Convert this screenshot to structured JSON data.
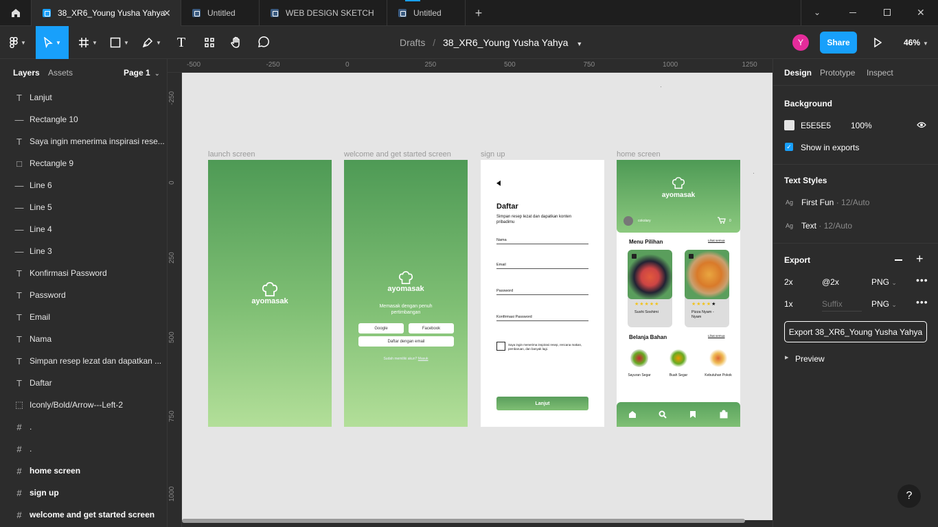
{
  "tabs": [
    {
      "label": "38_XR6_Young Yusha Yahya",
      "active": true
    },
    {
      "label": "Untitled"
    },
    {
      "label": "WEB DESIGN SKETCH"
    },
    {
      "label": "Untitled"
    }
  ],
  "toolbar": {
    "breadcrumb_root": "Drafts",
    "breadcrumb_sep": "/",
    "file_name": "38_XR6_Young Yusha Yahya",
    "avatar_letter": "Y",
    "share_label": "Share",
    "zoom": "46%"
  },
  "left_panel": {
    "tabs": [
      "Layers",
      "Assets"
    ],
    "page": "Page 1",
    "layers": [
      {
        "icon": "text-icon",
        "glyph": "T",
        "label": "Lanjut"
      },
      {
        "icon": "line-icon",
        "glyph": "—",
        "label": "Rectangle 10"
      },
      {
        "icon": "text-icon",
        "glyph": "T",
        "label": "Saya ingin menerima inspirasi rese..."
      },
      {
        "icon": "rectangle-icon",
        "glyph": "□",
        "label": "Rectangle 9"
      },
      {
        "icon": "line-icon",
        "glyph": "—",
        "label": "Line 6"
      },
      {
        "icon": "line-icon",
        "glyph": "—",
        "label": "Line 5"
      },
      {
        "icon": "line-icon",
        "glyph": "—",
        "label": "Line 4"
      },
      {
        "icon": "line-icon",
        "glyph": "—",
        "label": "Line 3"
      },
      {
        "icon": "text-icon",
        "glyph": "T",
        "label": "Konfirmasi Password"
      },
      {
        "icon": "text-icon",
        "glyph": "T",
        "label": "Password"
      },
      {
        "icon": "text-icon",
        "glyph": "T",
        "label": "Email"
      },
      {
        "icon": "text-icon",
        "glyph": "T",
        "label": "Nama"
      },
      {
        "icon": "text-icon",
        "glyph": "T",
        "label": "Simpan resep lezat dan dapatkan ..."
      },
      {
        "icon": "text-icon",
        "glyph": "T",
        "label": "Daftar"
      },
      {
        "icon": "component-icon",
        "glyph": "⬚",
        "label": "Iconly/Bold/Arrow---Left-2"
      },
      {
        "icon": "frame-icon",
        "glyph": "#",
        "label": "."
      },
      {
        "icon": "frame-icon",
        "glyph": "#",
        "label": "."
      },
      {
        "icon": "frame-icon",
        "glyph": "#",
        "label": "home screen",
        "bold": true
      },
      {
        "icon": "frame-icon",
        "glyph": "#",
        "label": "sign up",
        "bold": true
      },
      {
        "icon": "frame-icon",
        "glyph": "#",
        "label": "welcome and get started screen",
        "bold": true
      }
    ]
  },
  "rulers": {
    "h": [
      "-500",
      "-250",
      "0",
      "250",
      "500",
      "750",
      "1000",
      "1250"
    ],
    "v": [
      "-250",
      "0",
      "250",
      "500",
      "750",
      "1000"
    ]
  },
  "frames": {
    "launch": {
      "label": "launch screen",
      "brand": "ayomasak"
    },
    "welcome": {
      "label": "welcome and get started screen",
      "brand": "ayomasak",
      "tagline": "Memasak dengan penuh pertimbangan",
      "google": "Google",
      "facebook": "Facebook",
      "email_btn": "Daftar dengan email",
      "login_prompt": "Sudah memiliki akun?",
      "login_link": "Masuk"
    },
    "signup": {
      "label": "sign up",
      "title": "Daftar",
      "subtitle": "Simpan resep lezat dan dapatkan konten pribadimu",
      "fields": [
        "Nama",
        "Email",
        "Password",
        "Konfirmasi Password"
      ],
      "consent": "Saya ingin menerima inspirasi resep, rencana makan, pembaruan, dan banyak lagi.",
      "cta": "Lanjut"
    },
    "home": {
      "label": "home screen",
      "brand": "ayomasak",
      "user": "cokolary",
      "cart_count": "0",
      "menu_title": "Menu Pilihan",
      "see_all": "Lihat semua",
      "dishes": [
        {
          "name": "Sushi Soshimi"
        },
        {
          "name": "Pizza Nyam - Nyam"
        }
      ],
      "shop_title": "Belanja Bahan",
      "shop_see_all": "Lihat semua",
      "categories": [
        "Sayuran Segar",
        "Buah Segar",
        "Kebutuhan Pokok"
      ]
    }
  },
  "right_panel": {
    "tabs": [
      "Design",
      "Prototype",
      "Inspect"
    ],
    "background_title": "Background",
    "bg_hex": "E5E5E5",
    "bg_opacity": "100%",
    "show_in_exports": "Show in exports",
    "text_styles_title": "Text Styles",
    "text_styles": [
      {
        "name": "First Fun",
        "meta": "· 12/Auto"
      },
      {
        "name": "Text",
        "meta": "· 12/Auto"
      }
    ],
    "export_title": "Export",
    "exports": [
      {
        "scale": "2x",
        "suffix": "@2x",
        "format": "PNG"
      },
      {
        "scale": "1x",
        "suffix": "Suffix",
        "format": "PNG"
      }
    ],
    "export_button": "Export 38_XR6_Young Yusha Yahya",
    "preview": "Preview"
  },
  "help": "?",
  "colors": {
    "accent": "#18a0fb",
    "avatar": "#e52c9b",
    "green": "#5aa35e"
  }
}
